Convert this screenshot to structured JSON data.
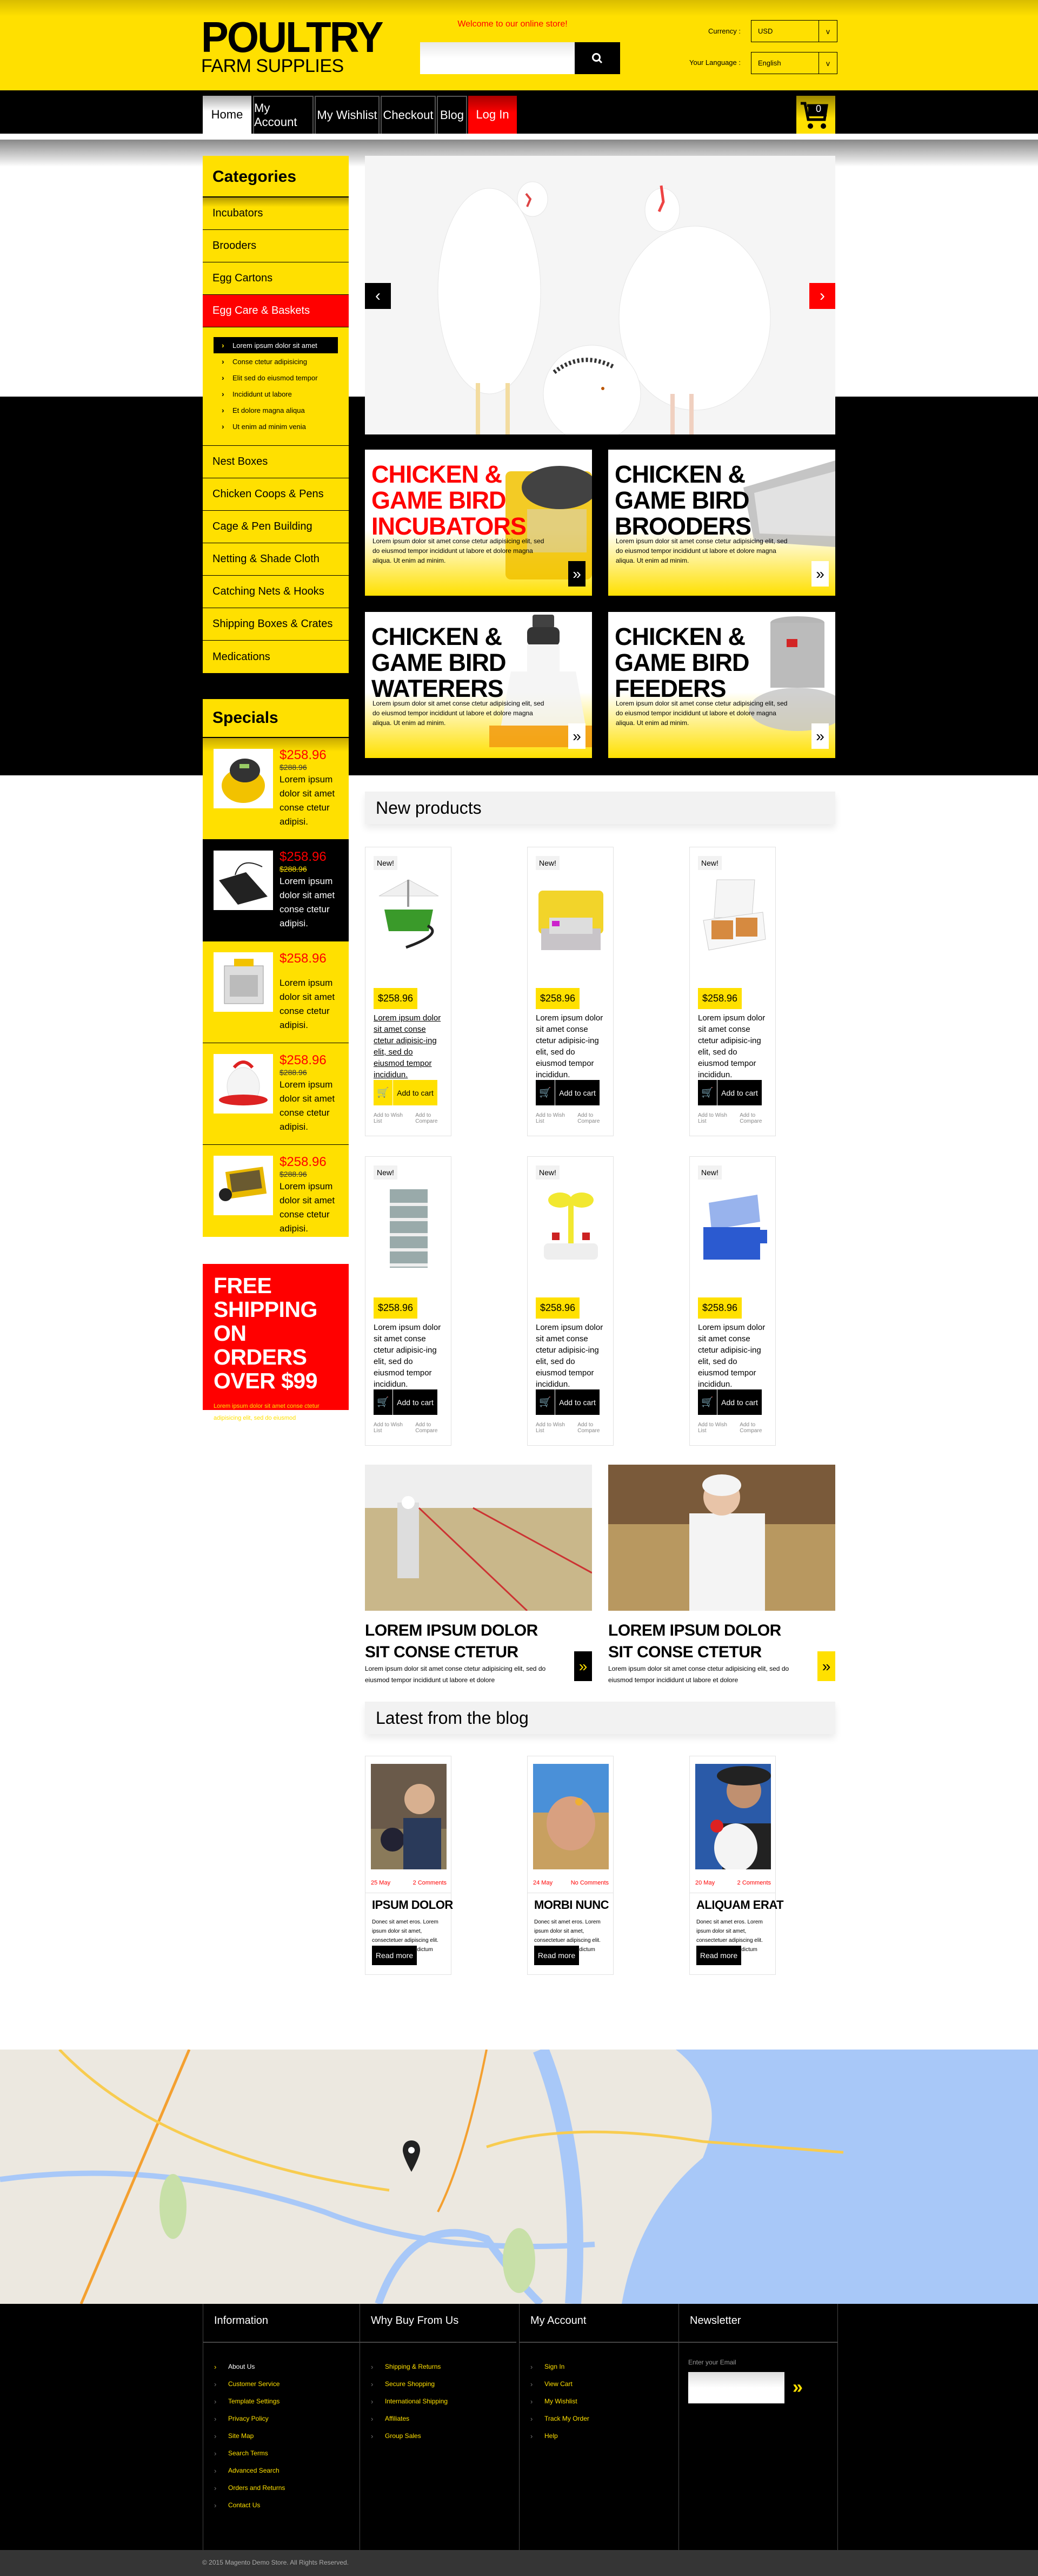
{
  "header": {
    "logo_line1": "POULTRY",
    "logo_line2": "FARM SUPPLIES",
    "welcome": "Welcome to our online store!",
    "search_placeholder": "",
    "currency_label": "Currency :",
    "currency_value": "USD",
    "language_label": "Your Language :",
    "language_value": "English",
    "cart_count": "0"
  },
  "nav": [
    {
      "label": "Home",
      "state": "active"
    },
    {
      "label": "My Account"
    },
    {
      "label": "My Wishlist"
    },
    {
      "label": "Checkout"
    },
    {
      "label": "Blog"
    },
    {
      "label": "Log In",
      "state": "highlight"
    }
  ],
  "colors": {
    "brand_yellow": "#ffe000",
    "accent_red": "#ff0000",
    "black": "#000000"
  },
  "categories": {
    "title": "Categories",
    "items": [
      "Incubators",
      "Brooders",
      "Egg Cartons",
      "Egg Care & Baskets"
    ],
    "active_index": 3,
    "subitems": [
      "Lorem ipsum dolor sit amet",
      "Conse ctetur adipisicing",
      "Elit sed do eiusmod tempor",
      "Incididunt ut labore",
      "Et dolore magna aliqua",
      "Ut enim ad minim venia"
    ],
    "more_items": [
      "Nest Boxes",
      "Chicken Coops & Pens",
      "Cage & Pen Building",
      "Netting & Shade Cloth",
      "Catching Nets & Hooks",
      "Shipping Boxes & Crates",
      "Medications"
    ]
  },
  "specials": {
    "title": "Specials",
    "items": [
      {
        "price": "$258.96",
        "old_price": "$288.96",
        "desc": "Lorem ipsum dolor sit amet conse ctetur adipisi."
      },
      {
        "price": "$258.96",
        "old_price": "$288.96",
        "desc": "Lorem ipsum dolor sit amet conse ctetur adipisi."
      },
      {
        "price": "$258.96",
        "old_price": "",
        "desc": "Lorem ipsum dolor sit amet conse ctetur adipisi."
      },
      {
        "price": "$258.96",
        "old_price": "$288.96",
        "desc": "Lorem ipsum dolor sit amet conse ctetur adipisi."
      },
      {
        "price": "$258.96",
        "old_price": "$288.96",
        "desc": "Lorem ipsum dolor sit amet conse ctetur adipisi."
      }
    ]
  },
  "free_shipping": {
    "title": "FREE SHIPPING ON ORDERS OVER $99",
    "text": "Lorem ipsum dolor sit amet conse ctetur adipisicing elit, sed do eiusmod"
  },
  "slider": {
    "prev": "‹",
    "next": "›"
  },
  "banners": [
    {
      "title": "CHICKEN & GAME BIRD INCUBATORS",
      "text": "Lorem ipsum dolor sit amet conse ctetur adipisicing elit, sed do eiusmod tempor incididunt ut labore et dolore magna aliqua. Ut enim ad minim.",
      "arrow": "»"
    },
    {
      "title": "CHICKEN & GAME BIRD BROODERS",
      "text": "Lorem ipsum dolor sit amet conse ctetur adipisicing elit, sed do eiusmod tempor incididunt ut labore et dolore magna aliqua. Ut enim ad minim.",
      "arrow": "»"
    },
    {
      "title": "CHICKEN & GAME BIRD WATERERS",
      "text": "Lorem ipsum dolor sit amet conse ctetur adipisicing elit, sed do eiusmod tempor incididunt ut labore et dolore magna aliqua. Ut enim ad minim.",
      "arrow": "»"
    },
    {
      "title": "CHICKEN & GAME BIRD FEEDERS",
      "text": "Lorem ipsum dolor sit amet conse ctetur adipisicing elit, sed do eiusmod tempor incididunt ut labore et dolore magna aliqua. Ut enim ad minim.",
      "arrow": "»"
    }
  ],
  "new_products": {
    "title": "New products",
    "badge": "New!",
    "add_to_cart": "Add to cart",
    "wishlist": "Add to Wish List",
    "compare": "Add to Compare",
    "items": [
      {
        "price": "$258.96",
        "desc": "Lorem ipsum dolor sit amet conse ctetur adipisic-ing elit, sed do eiusmod tempor incididun.",
        "image": "green-waterer"
      },
      {
        "price": "$258.96",
        "desc": "Lorem ipsum dolor sit amet conse ctetur adipisic-ing elit, sed do eiusmod tempor incididun.",
        "image": "yellow-incubator"
      },
      {
        "price": "$258.96",
        "desc": "Lorem ipsum dolor sit amet conse ctetur adipisic-ing elit, sed do eiusmod tempor incididun.",
        "image": "egg-incubator"
      },
      {
        "price": "$258.96",
        "desc": "Lorem ipsum dolor sit amet conse ctetur adipisic-ing elit, sed do eiusmod tempor incididun.",
        "image": "cage-rack"
      },
      {
        "price": "$258.96",
        "desc": "Lorem ipsum dolor sit amet conse ctetur adipisic-ing elit, sed do eiusmod tempor incididun.",
        "image": "nipple-drinker"
      },
      {
        "price": "$258.96",
        "desc": "Lorem ipsum dolor sit amet conse ctetur adipisic-ing elit, sed do eiusmod tempor incididun.",
        "image": "blue-incubator"
      }
    ]
  },
  "promos": [
    {
      "title": "LOREM IPSUM DOLOR SIT CONSE CTETUR",
      "text": "Lorem ipsum dolor sit amet conse ctetur adipisicing elit, sed do eiusmod tempor incididunt ut labore et dolore",
      "arrow": "»"
    },
    {
      "title": "LOREM IPSUM DOLOR SIT CONSE CTETUR",
      "text": "Lorem ipsum dolor sit amet conse ctetur adipisicing elit, sed do eiusmod tempor incididunt ut labore et dolore",
      "arrow": "»"
    }
  ],
  "blog": {
    "title": "Latest from the blog",
    "read_more": "Read more",
    "posts": [
      {
        "date": "25 May",
        "comments": "2 Comments",
        "title": "IPSUM DOLOR",
        "text": "Donec sit amet eros. Lorem ipsum dolor sit amet, consectetuer adipiscing elit. Mauris fermentum dictum magna."
      },
      {
        "date": "24 May",
        "comments": "No Comments",
        "title": "MORBI NUNC",
        "text": "Donec sit amet eros. Lorem ipsum dolor sit amet, consectetuer adipiscing elit. Mauris fermentum dictum magna."
      },
      {
        "date": "20 May",
        "comments": "2 Comments",
        "title": "ALIQUAM ERAT",
        "text": "Donec sit amet eros. Lorem ipsum dolor sit amet, consectetuer adipiscing elit. Mauris fermentum dictum magna."
      }
    ]
  },
  "footer": {
    "columns": [
      {
        "title": "Information",
        "links": [
          "About Us",
          "Customer Service",
          "Template Settings",
          "Privacy Policy",
          "Site Map",
          "Search Terms",
          "Advanced Search",
          "Orders and Returns",
          "Contact Us"
        ]
      },
      {
        "title": "Why Buy From Us",
        "links": [
          "Shipping & Returns",
          "Secure Shopping",
          "International Shipping",
          "Affiliates",
          "Group Sales"
        ]
      },
      {
        "title": "My Account",
        "links": [
          "Sign In",
          "View Cart",
          "My Wishlist",
          "Track My Order",
          "Help"
        ]
      }
    ],
    "newsletter": {
      "title": "Newsletter",
      "label": "Enter your Email",
      "submit": "»"
    },
    "copyright": "© 2015 Magento Demo Store. All Rights Reserved."
  }
}
